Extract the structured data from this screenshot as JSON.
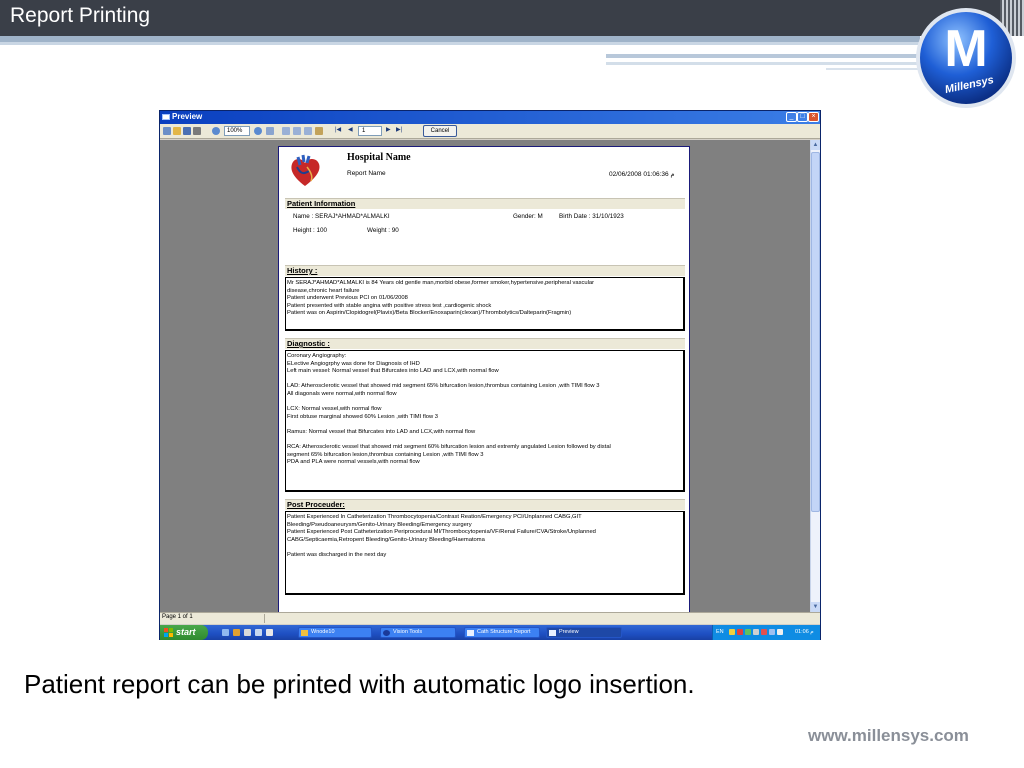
{
  "slide": {
    "title": "Report Printing",
    "caption": "Patient report can be printed with automatic logo insertion.",
    "url": "www.millensys.com",
    "logo_letter": "M",
    "logo_text": "Millensys"
  },
  "window": {
    "title": "Preview",
    "toolbar": {
      "zoom": "100%",
      "page": "1",
      "cancel_label": "Cancel"
    },
    "status": "Page 1 of 1"
  },
  "report": {
    "hospital_name": "Hospital Name",
    "report_name": "Report Name",
    "datetime": "02/06/2008 01:06:36 م",
    "patient_info": {
      "heading": "Patient Information",
      "name": "Name : SERAJ*AHMAD*ALMALKI",
      "gender": "Gender: M",
      "birth_date": "Birth Date : 31/10/1923",
      "height": "Height : 100",
      "weight": "Weight : 90"
    },
    "history": {
      "heading": "History :",
      "lines": [
        "Mr SERAJ*AHMAD*ALMALKI is 84 Years old gentle man,morbid obese,former smoker,hypertensive,peripheral vascular",
        "disease,chronic heart failure",
        "Patient underwent Previous PCI on 01/06/2008",
        "Patient presented with stable angina with positive stress test ,cardiogenic shock",
        "Patient was on Aspirin/Clopidogrel(Plavix)/Beta Blocker/Enoxaparin(clexan)/Thrombolytics/Dalteparin(Fragmin)"
      ]
    },
    "diagnostic": {
      "heading": "Diagnostic :",
      "lines": [
        "Coronary Angiography:",
        "ELective Angiogrphy was done for Diagnosis of IHD",
        "Left main vessel: Normal vessel that Bifurcates into LAD and LCX,with normal flow",
        "",
        "LAD: Atherosclerotic vessel that showed mid segment 65% bifurcation lesion,thrombus containing Lesion ,with TIMI flow 3",
        "All diagonals were normal,with normal flow",
        "",
        "LCX: Normal vessel,with normal flow",
        "First obtuse marginal showed 60% Lesion ,with TIMI flow 3",
        "",
        "Ramus: Normal vessel that Bifurcates into LAD and LCX,with normal flow",
        "",
        "RCA: Atherosclerotic vessel that showed mid segment 60% bifurcation lesion and extremly angulated Lesion followed by distal",
        "segment 65% bifurcation lesion,thrombus containing Lesion ,with TIMI flow 3",
        "PDA and PLA were normal vessels,with normal flow"
      ]
    },
    "post_procedure": {
      "heading": "Post Proceuder:",
      "lines": [
        "Patient Experienced In Catheterization Thrombocytopenia/Contrast Reation/Emergency PCI/Unplanned CABG,GIT",
        "Bleeding/Pseudoaneurysm/Genito-Urinary Bleeding/Emergency surgery",
        "Patient Experienced Post Catheterization Periprocedural MI/Thrombocytopenia/VF/Renal Failure/CVA/Stroke/Unplanned",
        "CABG/Septicaemia,Retropent Bleeding/Genito-Urinary Bleeding/Haematoma",
        "",
        "Patient was discharged in the next day"
      ]
    }
  },
  "taskbar": {
    "start_label": "start",
    "tasks": [
      "Wnode10",
      "Vision Tools",
      "Cath Structure Report",
      "Preview"
    ],
    "language": "EN",
    "clock": "01:06 م"
  },
  "colors": {
    "title_bar": "#3a3f48",
    "window_title": "#0a3fbf",
    "taskbar": "#1e4fc2",
    "logo_blue": "#1f5fd6",
    "url_gray": "#8a8f98"
  },
  "icons": [
    "heart-icon",
    "close-icon",
    "minimize-icon",
    "maximize-icon",
    "windows-flag-icon",
    "printer-icon",
    "zoom-icon"
  ]
}
